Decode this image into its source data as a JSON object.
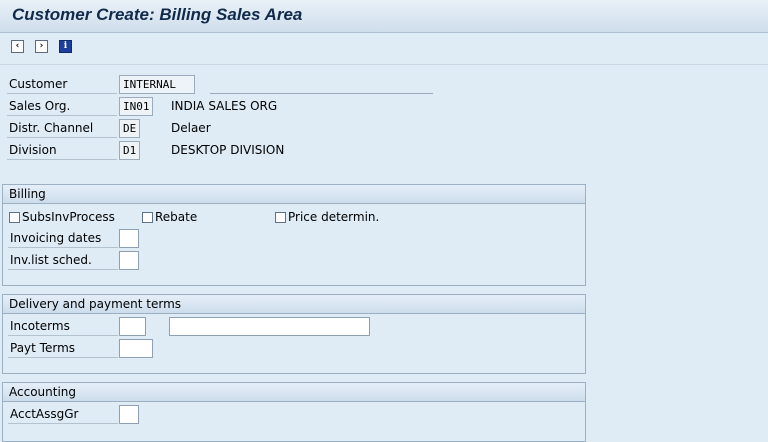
{
  "header": {
    "title": "Customer Create: Billing Sales Area"
  },
  "toolbar": {
    "icons": [
      "previous-screen-icon",
      "next-screen-icon",
      "info-icon"
    ]
  },
  "top": {
    "customer": {
      "label": "Customer",
      "value": "INTERNAL"
    },
    "sales_org": {
      "label": "Sales Org.",
      "value": "IN01",
      "desc": "INDIA SALES ORG"
    },
    "distr_channel": {
      "label": "Distr. Channel",
      "value": "DE",
      "desc": "Delaer"
    },
    "division": {
      "label": "Division",
      "value": "D1",
      "desc": "DESKTOP DIVISION"
    }
  },
  "billing": {
    "title": "Billing",
    "subs_inv": "SubsInvProcess",
    "rebate": "Rebate",
    "price_determin": "Price determin.",
    "invoicing_dates": {
      "label": "Invoicing dates",
      "value": ""
    },
    "inv_list_sched": {
      "label": "Inv.list sched.",
      "value": ""
    }
  },
  "delivery": {
    "title": "Delivery and payment terms",
    "incoterms": {
      "label": "Incoterms",
      "value": "",
      "value2": ""
    },
    "payt_terms": {
      "label": "Payt Terms",
      "value": ""
    }
  },
  "accounting": {
    "title": "Accounting",
    "acct_assg_gr": {
      "label": "AcctAssgGr",
      "value": ""
    }
  },
  "colors": {
    "background": "#dfebf5",
    "title": "#102a4a",
    "field_border": "#8ea0b3"
  }
}
